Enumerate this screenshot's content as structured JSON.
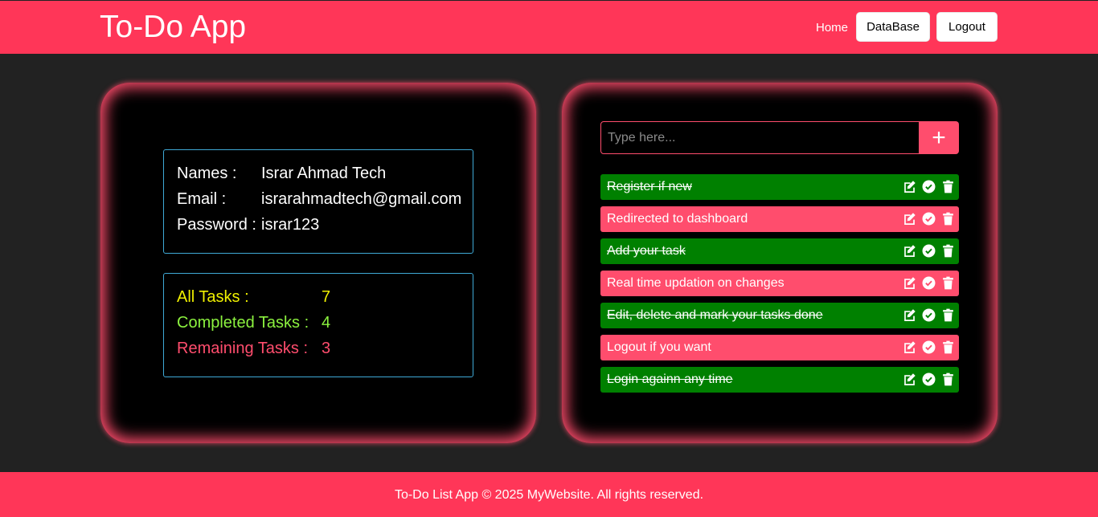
{
  "header": {
    "brand": "To-Do App",
    "nav": {
      "home": "Home",
      "database": "DataBase",
      "logout": "Logout"
    }
  },
  "profile": {
    "name_label": "Names :",
    "name": "Israr Ahmad Tech",
    "email_label": "Email :",
    "email": "israrahmadtech@gmail.com",
    "password_label": "Password :",
    "password": "israr123"
  },
  "stats": {
    "all_label": "All Tasks :",
    "all": "7",
    "completed_label": "Completed Tasks :",
    "completed": "4",
    "remaining_label": "Remaining Tasks :",
    "remaining": "3"
  },
  "task_input": {
    "placeholder": "Type here...",
    "add_icon": "plus-icon"
  },
  "tasks": [
    {
      "text": "Register if new",
      "done": true
    },
    {
      "text": "Redirected to dashboard",
      "done": false
    },
    {
      "text": "Add your task",
      "done": true
    },
    {
      "text": "Real time updation on changes",
      "done": false
    },
    {
      "text": "Edit, delete and mark your tasks done",
      "done": true
    },
    {
      "text": "Logout if you want",
      "done": false
    },
    {
      "text": "Login againn any time",
      "done": true
    }
  ],
  "task_icons": [
    "edit-icon",
    "check-circle-icon",
    "trash-icon"
  ],
  "colors": {
    "brand": "#ff3658",
    "done": "#008000",
    "pending": "#ff4d6d",
    "all": "#f0f000",
    "completed": "#8cf23f",
    "remaining": "#ff4d6d"
  },
  "footer": {
    "text": "To-Do List App © 2025 MyWebsite. All rights reserved."
  }
}
